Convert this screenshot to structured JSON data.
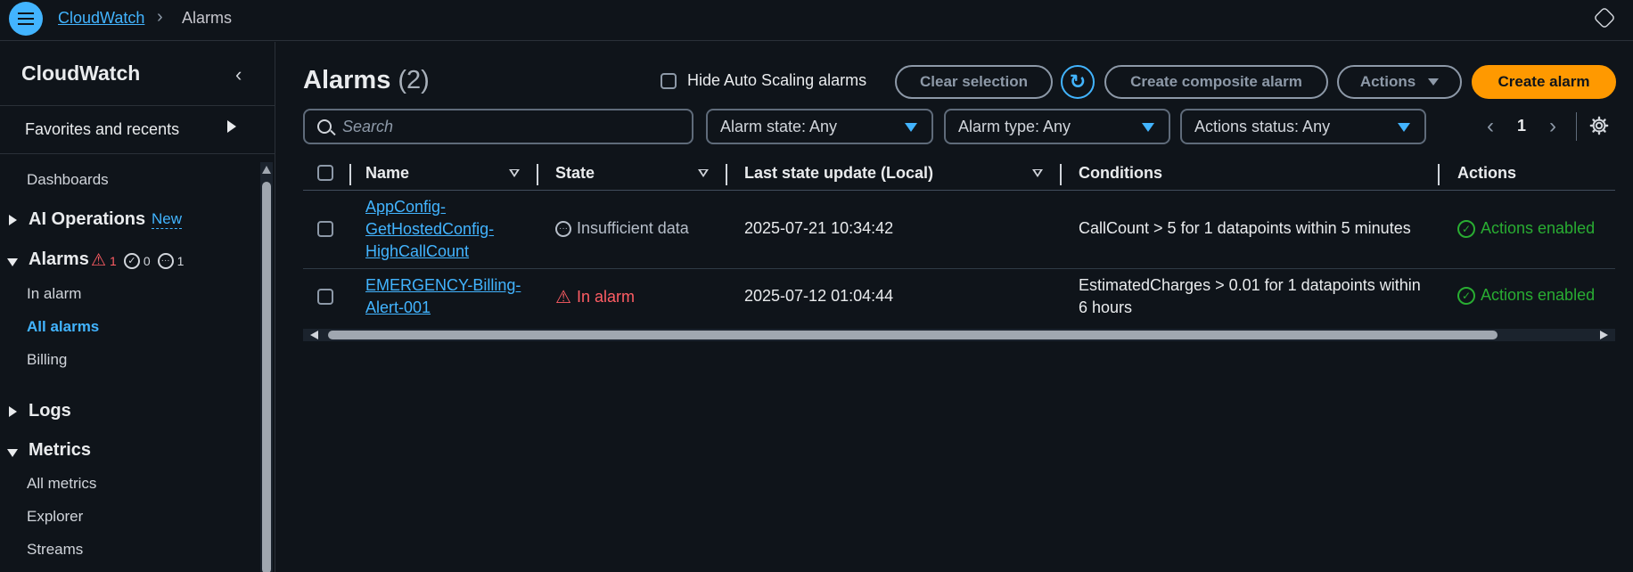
{
  "breadcrumb": {
    "root": "CloudWatch",
    "current": "Alarms"
  },
  "sidebar": {
    "title": "CloudWatch",
    "favorites": "Favorites and recents",
    "dashboards": "Dashboards",
    "ai_operations": "AI Operations",
    "new_badge": "New",
    "alarms": "Alarms",
    "alarm_counts": {
      "in_alarm": "1",
      "ok": "0",
      "insufficient": "1"
    },
    "alarm_items": [
      "In alarm",
      "All alarms",
      "Billing"
    ],
    "logs": "Logs",
    "metrics": "Metrics",
    "metric_items": [
      "All metrics",
      "Explorer",
      "Streams"
    ]
  },
  "main": {
    "title": "Alarms",
    "count": "(2)",
    "hide_auto_scaling": "Hide Auto Scaling alarms",
    "buttons": {
      "clear": "Clear selection",
      "composite": "Create composite alarm",
      "actions": "Actions",
      "create": "Create alarm"
    },
    "search_placeholder": "Search",
    "filters": {
      "state": "Alarm state: Any",
      "type": "Alarm type: Any",
      "actions_status": "Actions status: Any"
    },
    "page": "1"
  },
  "table": {
    "headers": {
      "name": "Name",
      "state": "State",
      "last_update": "Last state update (Local)",
      "conditions": "Conditions",
      "actions": "Actions"
    },
    "rows": [
      {
        "name_lines": [
          "AppConfig-",
          "GetHostedConfig-",
          "HighCallCount"
        ],
        "state": "Insufficient data",
        "last_update": "2025-07-21 10:34:42",
        "conditions": "CallCount > 5 for 1 datapoints within 5 minutes",
        "actions": "Actions enabled"
      },
      {
        "name_lines": [
          "EMERGENCY-Billing-",
          "Alert-001"
        ],
        "state": "In alarm",
        "last_update": "2025-07-12 01:04:44",
        "conditions_lines": [
          "EstimatedCharges > 0.01 for 1 datapoints within",
          "6 hours"
        ],
        "actions": "Actions enabled"
      }
    ]
  },
  "colors": {
    "background": "#0f141a",
    "link": "#42b4ff",
    "primary": "#ff9900",
    "alarm": "#ff5d64",
    "ok": "#29ad32"
  }
}
